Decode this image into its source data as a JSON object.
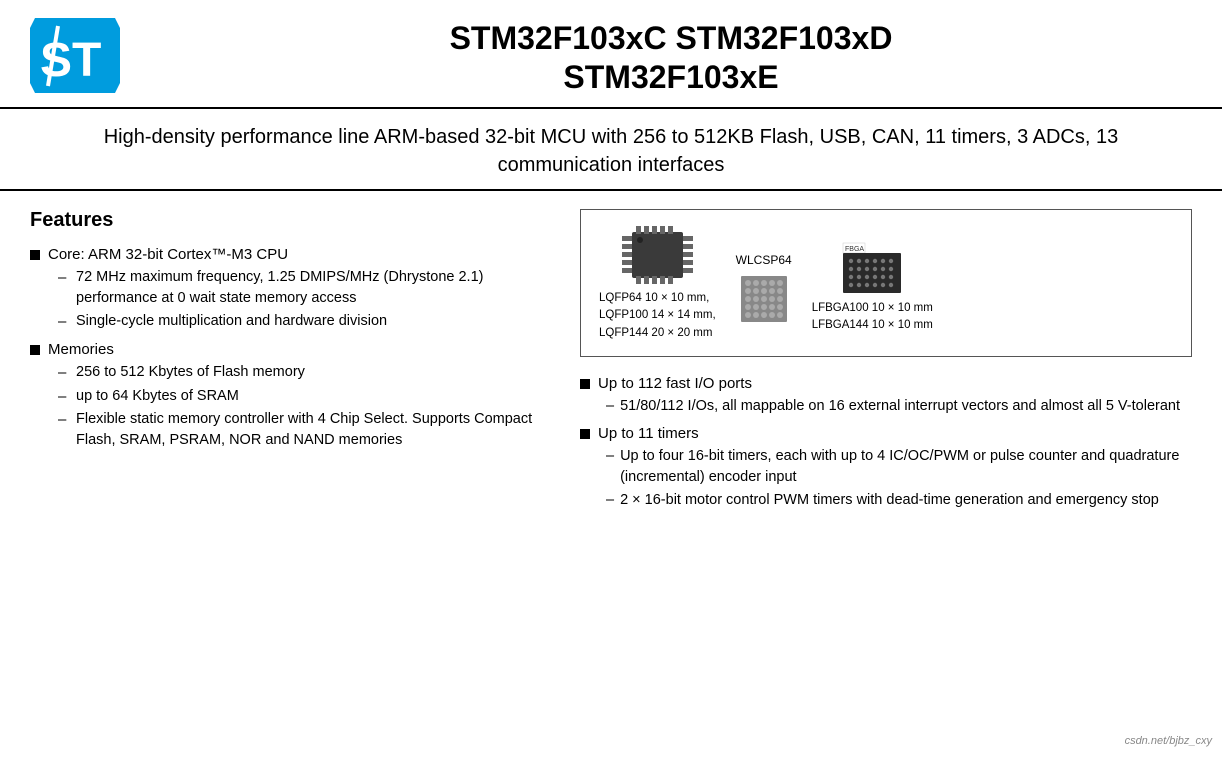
{
  "header": {
    "title_line1": "STM32F103xC STM32F103xD",
    "title_line2": "STM32F103xE"
  },
  "subtitle": "High-density performance line ARM-based 32-bit MCU with 256 to 512KB Flash, USB, CAN, 11 timers, 3 ADCs, 13 communication interfaces",
  "features": {
    "section_title": "Features",
    "left_bullets": [
      {
        "label": "Core: ARM 32-bit Cortex™-M3 CPU",
        "subs": [
          "72 MHz maximum frequency, 1.25 DMIPS/MHz (Dhrystone 2.1) performance at 0 wait state memory access",
          "Single-cycle multiplication and hardware division"
        ]
      },
      {
        "label": "Memories",
        "subs": [
          "256 to 512 Kbytes of Flash memory",
          "up to 64 Kbytes of SRAM",
          "Flexible static memory controller with 4 Chip Select. Supports Compact Flash, SRAM, PSRAM, NOR and NAND memories"
        ]
      }
    ],
    "packages": {
      "left_label": "LQFP64 10 × 10 mm,\nLQFP100 14 × 14 mm,\nLQFP144 20 × 20 mm",
      "middle_label": "WLCSP64",
      "right_label": "LFBGA100 10 × 10 mm\nLFBGA144 10 × 10 mm"
    },
    "right_bullets": [
      {
        "label": "Up to 112 fast I/O ports",
        "subs": [
          "51/80/112 I/Os, all mappable on 16 external interrupt vectors and almost all 5 V-tolerant"
        ]
      },
      {
        "label": "Up to 11 timers",
        "subs": [
          "Up to four 16-bit timers, each with up to 4 IC/OC/PWM or pulse counter and quadrature (incremental) encoder input",
          "2 × 16-bit motor control PWM timers with dead-time generation and emergency stop"
        ]
      }
    ]
  },
  "watermark": "csdn.net/bjbz_cxy"
}
